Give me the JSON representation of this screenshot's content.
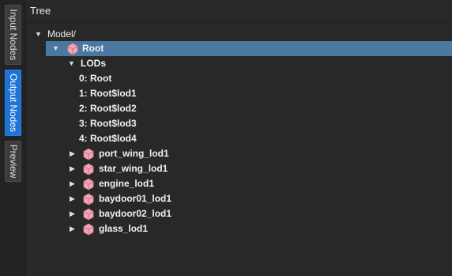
{
  "tabs": {
    "input": "Input Nodes",
    "output": "Output Nodes",
    "preview": "Preview"
  },
  "panel": {
    "title": "Tree"
  },
  "tree": {
    "model": "Model/",
    "root": "Root",
    "lods": "LODs",
    "lod_items": [
      "0: Root",
      "1: Root$lod1",
      "2: Root$lod2",
      "3: Root$lod3",
      "4: Root$lod4"
    ],
    "children": [
      "port_wing_lod1",
      "star_wing_lod1",
      "engine_lod1",
      "baydoor01_lod1",
      "baydoor02_lod1",
      "glass_lod1"
    ]
  },
  "colors": {
    "accent_tab": "#1e73d6",
    "selection": "#4a78a0",
    "cube_icon": "#f4a6b8"
  }
}
